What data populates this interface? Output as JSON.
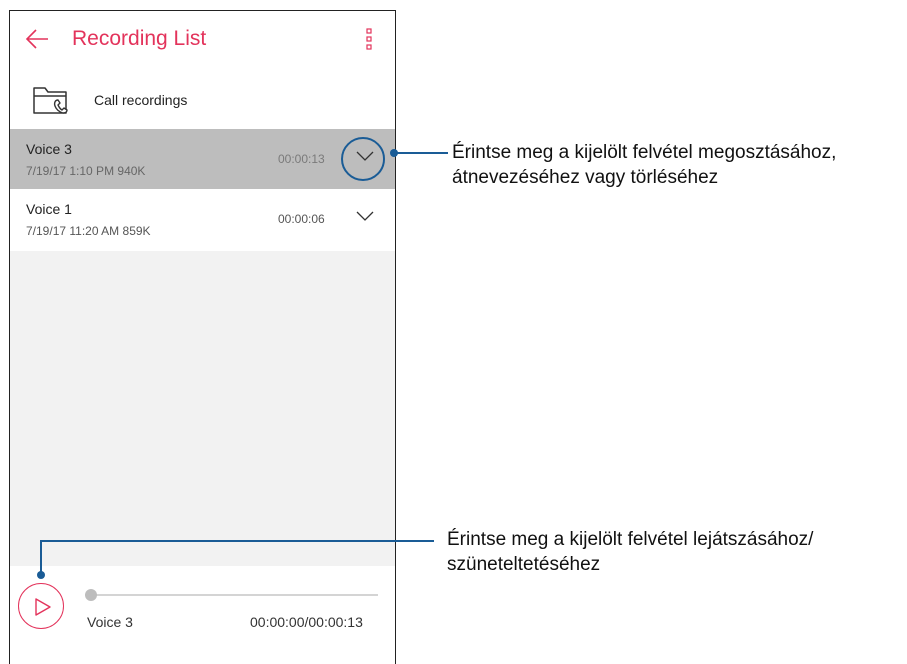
{
  "appbar": {
    "title": "Recording List",
    "back_icon": "arrow-left-icon",
    "more_icon": "more-vertical-icon"
  },
  "folder": {
    "label": "Call recordings",
    "icon": "call-folder-icon"
  },
  "recordings": [
    {
      "name": "Voice 3",
      "meta": "7/19/17 1:10 PM   940K",
      "duration": "00:00:13",
      "selected": true
    },
    {
      "name": "Voice 1",
      "meta": "7/19/17 11:20 AM   859K",
      "duration": "00:00:06",
      "selected": false
    }
  ],
  "player": {
    "name": "Voice 3",
    "time": "00:00:00/00:00:13",
    "progress": 0,
    "play_icon": "play-icon"
  },
  "callouts": {
    "expand": "Érintse meg a kijelölt felvétel megosztásához,\nátnevezéséhez vagy törléséhez",
    "play": "Érintse meg a kijelölt felvétel lejátszásához/\nszüneteltetéséhez"
  },
  "colors": {
    "accent": "#e3335b",
    "callout": "#1a5c96",
    "selected_row": "#bdbdbd"
  }
}
